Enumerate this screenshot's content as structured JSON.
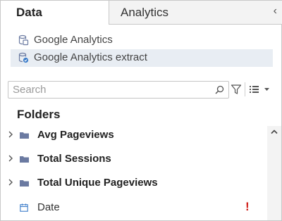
{
  "tabs": {
    "data_label": "Data",
    "analytics_label": "Analytics",
    "collapse_glyph": "‹"
  },
  "data_sources": [
    {
      "label": "Google Analytics",
      "icon": "datasource-live-icon",
      "selected": false
    },
    {
      "label": "Google Analytics extract",
      "icon": "datasource-extract-icon",
      "selected": true
    }
  ],
  "search": {
    "placeholder": "Search",
    "value": ""
  },
  "folders": {
    "header": "Folders",
    "items": [
      {
        "label": "Avg Pageviews",
        "icon": "folder-icon"
      },
      {
        "label": "Total Sessions",
        "icon": "folder-icon"
      },
      {
        "label": "Total Unique Pageviews",
        "icon": "folder-icon"
      }
    ],
    "date_field": {
      "label": "Date",
      "icon": "calendar-icon",
      "error_mark": "!"
    }
  },
  "colors": {
    "accent": "#5b6fa0",
    "error": "#d0201a",
    "selected_bg": "#e8edf3",
    "folder": "#6b7aa1"
  }
}
